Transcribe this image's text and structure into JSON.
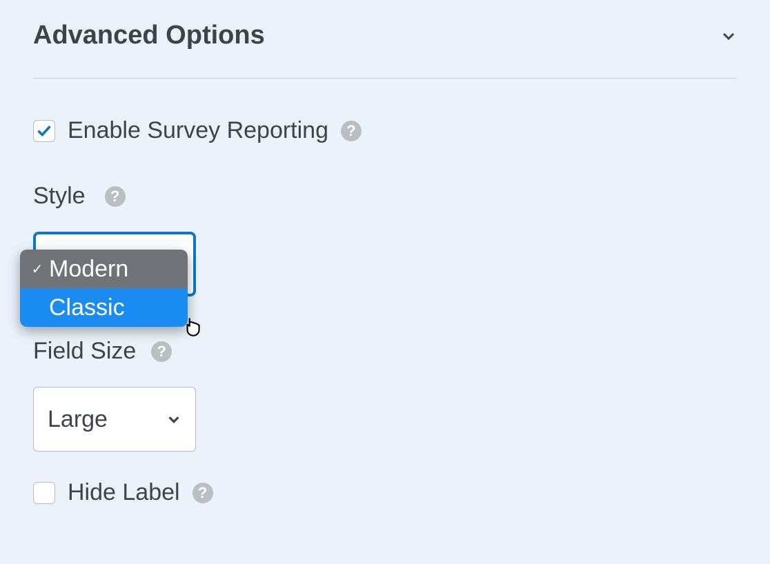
{
  "section_title": "Advanced Options",
  "enable_survey": {
    "label": "Enable Survey Reporting",
    "checked": true,
    "help": "?"
  },
  "style": {
    "label": "Style",
    "help": "?",
    "selected": "Modern",
    "options": [
      "Modern",
      "Classic"
    ],
    "highlighted": "Classic"
  },
  "field_size": {
    "label": "Field Size",
    "help": "?",
    "selected": "Large"
  },
  "hide_label": {
    "label": "Hide Label",
    "checked": false,
    "help": "?"
  }
}
